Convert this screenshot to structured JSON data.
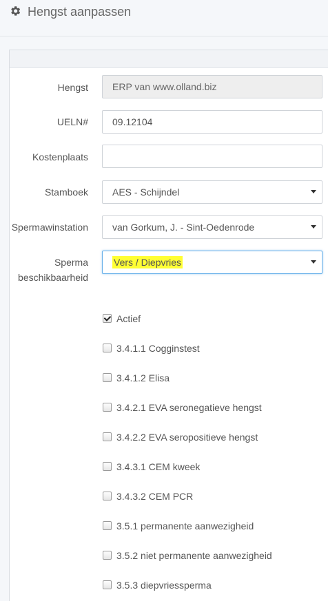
{
  "header": {
    "title": "Hengst aanpassen",
    "icon": "gear-icon"
  },
  "form": {
    "hengst": {
      "label": "Hengst",
      "value": "ERP van www.olland.biz"
    },
    "ueln": {
      "label": "UELN#",
      "value": "09.12104"
    },
    "kostenplaats": {
      "label": "Kostenplaats",
      "value": ""
    },
    "stamboek": {
      "label": "Stamboek",
      "value": "AES - Schijndel"
    },
    "spermawinstation": {
      "label": "Spermawinstation",
      "value": "van Gorkum, J. - Sint-Oedenrode"
    },
    "sperma_beschikbaarheid": {
      "label_line1": "Sperma",
      "label_line2": "beschikbaarheid",
      "value": "Vers / Diepvries",
      "highlight_color": "#ffff33"
    }
  },
  "checkboxes": [
    {
      "label": "Actief",
      "checked": true
    },
    {
      "label": "3.4.1.1 Cogginstest",
      "checked": false
    },
    {
      "label": "3.4.1.2 Elisa",
      "checked": false
    },
    {
      "label": "3.4.2.1 EVA seronegatieve hengst",
      "checked": false
    },
    {
      "label": "3.4.2.2 EVA seropositieve hengst",
      "checked": false
    },
    {
      "label": "3.4.3.1 CEM kweek",
      "checked": false
    },
    {
      "label": "3.4.3.2 CEM PCR",
      "checked": false
    },
    {
      "label": "3.5.1 permanente aanwezigheid",
      "checked": false
    },
    {
      "label": "3.5.2 niet permanente aanwezigheid",
      "checked": false
    },
    {
      "label": "3.5.3 diepvriessperma",
      "checked": false
    }
  ]
}
